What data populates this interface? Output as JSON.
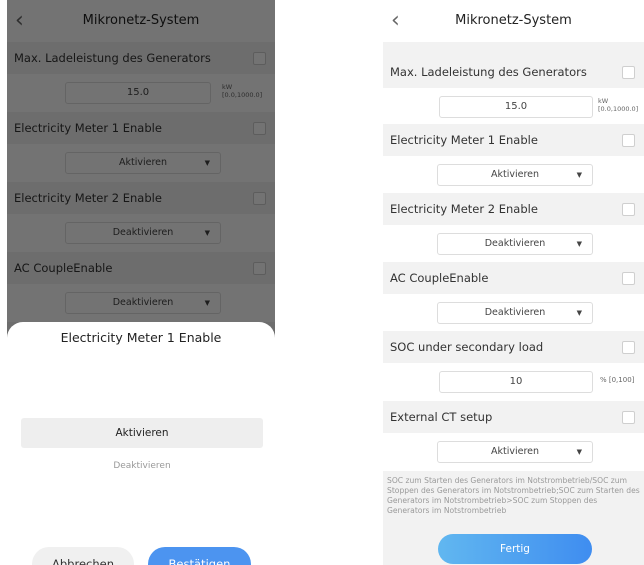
{
  "screen": {
    "title": "Mikronetz-System",
    "back_icon": "chevron-left-icon"
  },
  "settings": {
    "max_charge": {
      "label": "Max. Ladeleistung des Generators",
      "value": "15.0",
      "unit": "kW",
      "range": "[0.0,1000.0]"
    },
    "meter1": {
      "label": "Electricity Meter 1 Enable",
      "value": "Aktivieren"
    },
    "meter2": {
      "label": "Electricity Meter 2 Enable",
      "value": "Deaktivieren"
    },
    "ac_couple": {
      "label": "AC CoupleEnable",
      "value": "Deaktivieren"
    },
    "soc_secondary": {
      "label": "SOC under secondary load",
      "value": "10",
      "unit_range": "% [0,100]"
    },
    "external_ct": {
      "label": "External CT setup",
      "value": "Aktivieren"
    }
  },
  "note": "SOC zum Starten des Generators im Notstrombetrieb/SOC zum Stoppen des Generators im Notstrombetrieb;SOC zum Starten des Generators im Notstrombetrieb>SOC zum Stoppen des Generators im Notstrombetrieb",
  "done_button": "Fertig",
  "picker": {
    "title": "Electricity Meter 1 Enable",
    "options": [
      "Aktivieren",
      "Deaktivieren"
    ],
    "selected": "Aktivieren",
    "cancel": "Abbrechen",
    "confirm": "Bestätigen"
  },
  "colors": {
    "accent": "#4c94f0",
    "overlay": "#000000"
  }
}
